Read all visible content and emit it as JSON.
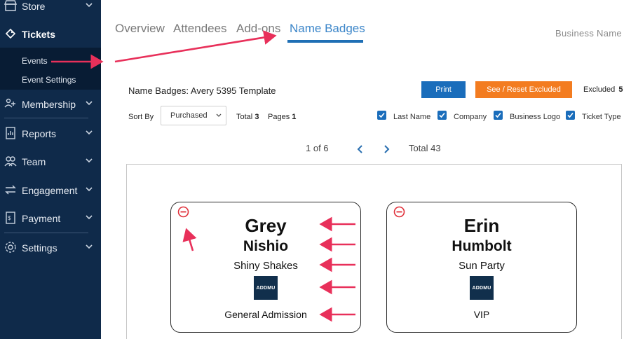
{
  "sidebar": {
    "items": [
      {
        "label": "Store"
      },
      {
        "label": "Tickets"
      },
      {
        "label": "Membership"
      },
      {
        "label": "Reports"
      },
      {
        "label": "Team"
      },
      {
        "label": "Engagement"
      },
      {
        "label": "Payment"
      },
      {
        "label": "Settings"
      }
    ],
    "submenu": [
      {
        "label": "Events"
      },
      {
        "label": "Event Settings"
      }
    ]
  },
  "tabs": [
    {
      "label": "Overview"
    },
    {
      "label": "Attendees"
    },
    {
      "label": "Add-ons"
    },
    {
      "label": "Name Badges",
      "active": true
    }
  ],
  "header": {
    "business": "Business Name"
  },
  "toolbar": {
    "template_title": "Name Badges: Avery 5395 Template",
    "print_label": "Print",
    "reset_label": "See / Reset Excluded",
    "excluded_label": "Excluded",
    "excluded_count": "5",
    "sort_label": "Sort By",
    "sort_value": "Purchased",
    "total_label": "Total",
    "total_count": "3",
    "pages_label": "Pages",
    "pages_count": "1",
    "checkboxes": [
      {
        "label": "Last Name",
        "checked": true
      },
      {
        "label": "Company",
        "checked": true
      },
      {
        "label": "Business Logo",
        "checked": true
      },
      {
        "label": "Ticket Type",
        "checked": true
      }
    ]
  },
  "pager": {
    "position": "1 of 6",
    "total_label": "Total",
    "total_count": "43"
  },
  "badges": [
    {
      "first": "Grey",
      "last": "Nishio",
      "company": "Shiny Shakes",
      "logo_text": "ADDMU",
      "ticket": "General Admission"
    },
    {
      "first": "Erin",
      "last": "Humbolt",
      "company": "Sun Party",
      "logo_text": "ADDMU",
      "ticket": "VIP"
    }
  ],
  "colors": {
    "sidebar": "#0f2a4a",
    "accent_blue": "#1a6dbb",
    "accent_orange": "#f37c20",
    "annotation": "#e8305a"
  }
}
